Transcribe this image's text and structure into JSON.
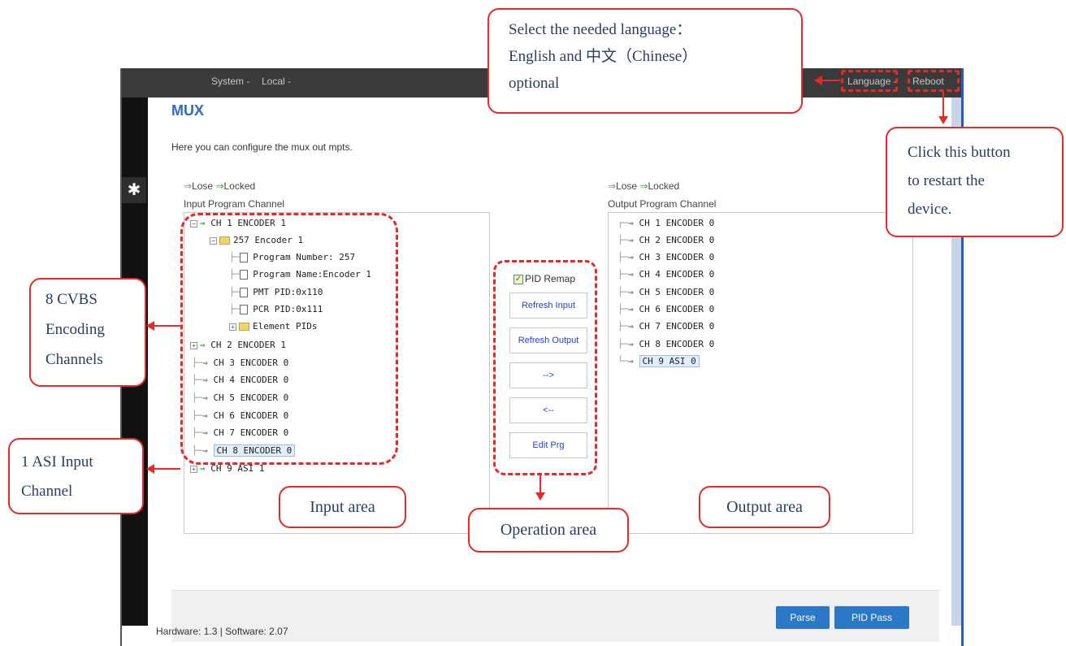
{
  "topbar": {
    "menu_system": "System -",
    "menu_local": "Local -",
    "menu_language": "Language -",
    "menu_reboot": "Reboot"
  },
  "page": {
    "title": "MUX",
    "description": "Here you can configure the mux out mpts."
  },
  "legend": {
    "lose": "Lose",
    "locked": "Locked"
  },
  "input_panel": {
    "label": "Input Program Channel",
    "rows": [
      "CH 1 ENCODER 1",
      "257 Encoder 1",
      "Program Number: 257",
      "Program Name:Encoder 1",
      "PMT PID:0x110",
      "PCR PID:0x111",
      "Element PIDs",
      "CH 2 ENCODER 1",
      "CH 3 ENCODER 0",
      "CH 4 ENCODER 0",
      "CH 5 ENCODER 0",
      "CH 6 ENCODER 0",
      "CH 7 ENCODER 0",
      "CH 8 ENCODER 0",
      "CH 9 ASI 1"
    ]
  },
  "output_panel": {
    "label": "Output Program Channel",
    "rows": [
      "CH 1 ENCODER 0",
      "CH 2 ENCODER 0",
      "CH 3 ENCODER 0",
      "CH 4 ENCODER 0",
      "CH 5 ENCODER 0",
      "CH 6 ENCODER 0",
      "CH 7 ENCODER 0",
      "CH 8 ENCODER 0",
      "CH 9 ASI 0"
    ]
  },
  "operations": {
    "pid_remap": "PID Remap",
    "refresh_input": "Refresh Input",
    "refresh_output": "Refresh Output",
    "move_right": "-->",
    "move_left": "<--",
    "edit_prg": "Edit Prg"
  },
  "bottom": {
    "parse": "Parse",
    "pid_pass": "PID Pass"
  },
  "footer": {
    "version": "Hardware: 1.3 | Software: 2.07"
  },
  "annotations": {
    "language_note_1": "Select  the  needed  language：",
    "language_note_2": "English  and  中文（Chinese）",
    "language_note_3": "optional",
    "reboot_note_1": "Click this button",
    "reboot_note_2": "to    restart    the",
    "reboot_note_3": "device.",
    "cvbs_note_1": "8    CVBS",
    "cvbs_note_2": "Encoding",
    "cvbs_note_3": "Channels",
    "asi_note_1": "1 ASI Input",
    "asi_note_2": "Channel",
    "input_area": "Input area",
    "operation_area": "Operation area",
    "output_area": "Output area"
  },
  "colors": {
    "accent": "#2b6cc4",
    "annotation_red": "#e62a2a",
    "button_blue": "#2b77c8",
    "locked_green": "#3aa83a"
  }
}
